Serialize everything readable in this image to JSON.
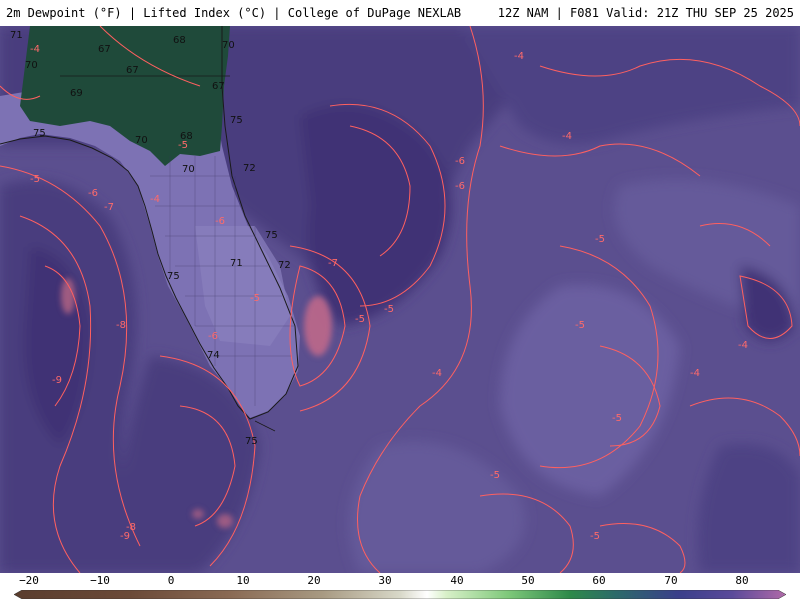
{
  "header": {
    "left": "2m Dewpoint (°F) | Lifted Index (°C) | College of DuPage NEXLAB",
    "right": "12Z NAM | F081 Valid: 21Z THU SEP 25 2025"
  },
  "colors": {
    "ocean_base": "#5b4f8f",
    "ocean_dark": "#4a3d7e",
    "ocean_darker": "#3f3374",
    "ocean_light": "#6b5fa0",
    "land_light": "#7d72b4",
    "land_green": "#1f4a3a",
    "li_contour": "#ff6060",
    "coast": "#1a1a1a"
  },
  "dewpoint_labels": [
    "71",
    "70",
    "67",
    "68",
    "70",
    "67",
    "69",
    "67",
    "75",
    "70",
    "68",
    "72",
    "75",
    "70",
    "75",
    "75",
    "71",
    "74",
    "72",
    "75"
  ],
  "lifted_index_labels": [
    "-4",
    "-5",
    "-6",
    "-7",
    "-4",
    "-5",
    "-6",
    "-7",
    "-6",
    "-8",
    "-9",
    "-8",
    "-9",
    "-5",
    "-5",
    "-4",
    "-5",
    "-4",
    "-4",
    "-5",
    "-4",
    "-5",
    "-6",
    "-5",
    "-4",
    "-5",
    "-6",
    "-5"
  ],
  "colorbar": {
    "ticks": [
      "−20",
      "−10",
      "0",
      "10",
      "20",
      "30",
      "40",
      "50",
      "60",
      "70",
      "80"
    ]
  }
}
